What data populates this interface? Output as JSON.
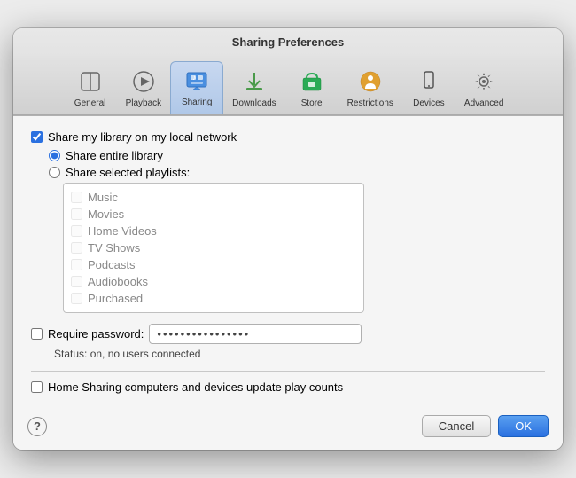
{
  "window": {
    "title": "Sharing Preferences"
  },
  "toolbar": {
    "items": [
      {
        "id": "general",
        "label": "General",
        "active": false
      },
      {
        "id": "playback",
        "label": "Playback",
        "active": false
      },
      {
        "id": "sharing",
        "label": "Sharing",
        "active": true
      },
      {
        "id": "downloads",
        "label": "Downloads",
        "active": false
      },
      {
        "id": "store",
        "label": "Store",
        "active": false
      },
      {
        "id": "restrictions",
        "label": "Restrictions",
        "active": false
      },
      {
        "id": "devices",
        "label": "Devices",
        "active": false
      },
      {
        "id": "advanced",
        "label": "Advanced",
        "active": false
      }
    ]
  },
  "content": {
    "share_library_label": "Share my library on my local network",
    "share_entire_label": "Share entire library",
    "share_selected_label": "Share selected playlists:",
    "playlists": [
      "Music",
      "Movies",
      "Home Videos",
      "TV Shows",
      "Podcasts",
      "Audiobooks",
      "Purchased"
    ],
    "require_password_label": "Require password:",
    "password_dots": "●●●●●●●●●●●●●●●●",
    "status_text": "Status: on, no users connected",
    "home_sharing_label": "Home Sharing computers and devices update play counts"
  },
  "footer": {
    "help_label": "?",
    "cancel_label": "Cancel",
    "ok_label": "OK"
  }
}
